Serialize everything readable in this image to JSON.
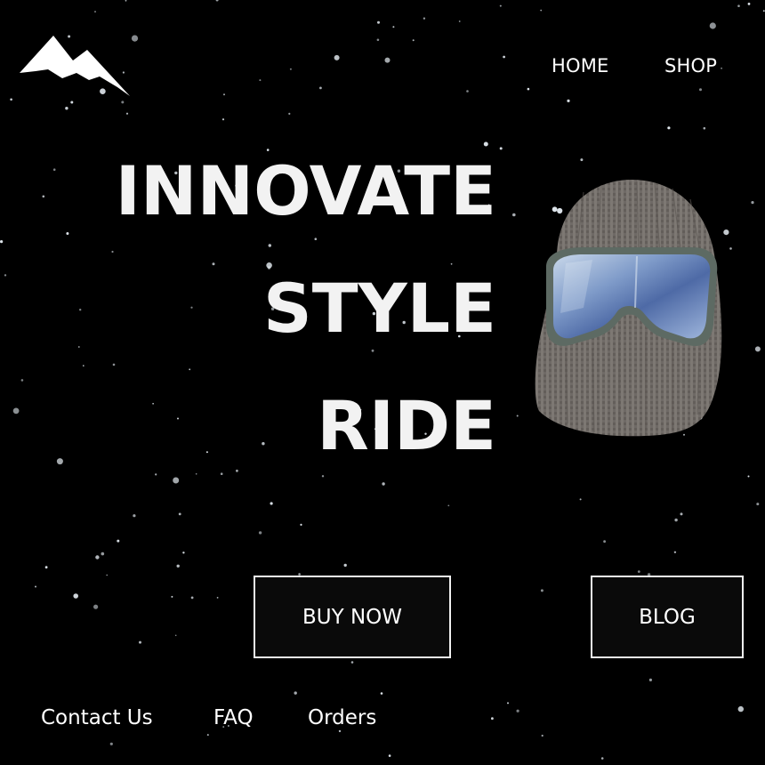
{
  "nav": {
    "home_label": "HOME",
    "shop_label": "SHOP"
  },
  "hero": {
    "line1": "INNOVATE",
    "line2": "STYLE",
    "line3": "RIDE"
  },
  "buttons": {
    "buy_label": "BUY NOW",
    "blog_label": "BLOG"
  },
  "footer": {
    "contact_label": "Contact Us",
    "faq_label": "FAQ",
    "orders_label": "Orders"
  },
  "icons": {
    "logo": "mountain-icon",
    "product": "balaclava-goggles-icon"
  },
  "colors": {
    "background": "#000000",
    "text": "#ffffff",
    "snow": "#dfe6ec"
  }
}
